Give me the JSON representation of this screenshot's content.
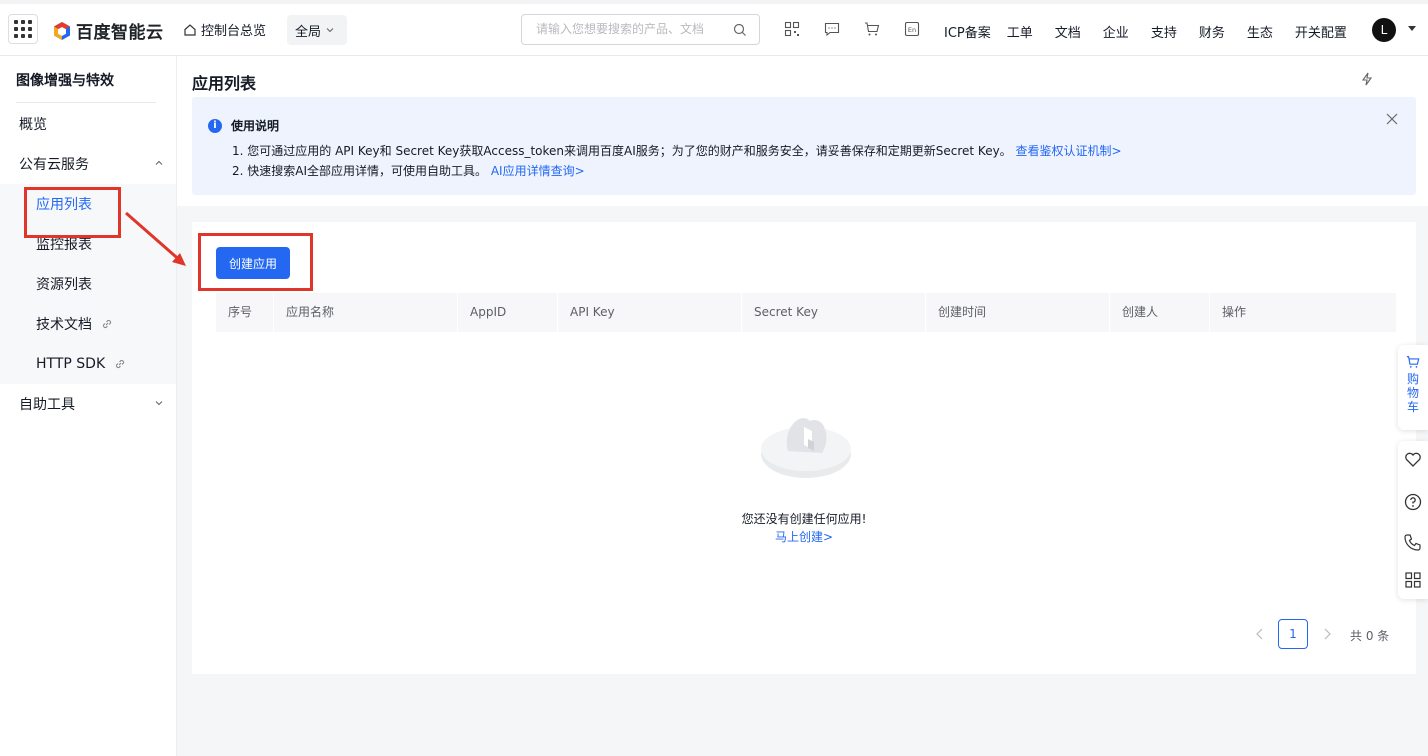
{
  "topbar": {
    "logo_text": "百度智能云",
    "home_label": "控制台总览",
    "region": "全局",
    "search_placeholder": "请输入您想要搜索的产品、文档",
    "links": [
      "ICP备案",
      "工单",
      "文档",
      "企业",
      "支持",
      "财务",
      "生态",
      "开关配置"
    ],
    "avatar_letter": "L"
  },
  "sidebar": {
    "title": "图像增强与特效",
    "overview": "概览",
    "group_public": "公有云服务",
    "items": [
      "应用列表",
      "监控报表",
      "资源列表",
      "技术文档",
      "HTTP SDK"
    ],
    "group_tools": "自助工具"
  },
  "main": {
    "title": "应用列表",
    "notice": {
      "title": "使用说明",
      "line1": "1. 您可通过应用的 API Key和 Secret Key获取Access_token来调用百度AI服务；为了您的财产和服务安全，请妥善保存和定期更新Secret Key。",
      "line1_link": "查看鉴权认证机制>",
      "line2": "2. 快速搜索AI全部应用详情，可使用自助工具。",
      "line2_link": "AI应用详情查询>"
    },
    "create_button": "创建应用",
    "columns": [
      "序号",
      "应用名称",
      "AppID",
      "API Key",
      "Secret Key",
      "创建时间",
      "创建人",
      "操作"
    ],
    "empty_text": "您还没有创建任何应用!",
    "empty_link": "马上创建>",
    "pagination": {
      "current": "1",
      "total": "共 0 条"
    }
  },
  "float": {
    "cart": [
      "购",
      "物",
      "车"
    ]
  },
  "colors": {
    "accent": "#2468f2",
    "annotation": "#e0352b"
  }
}
